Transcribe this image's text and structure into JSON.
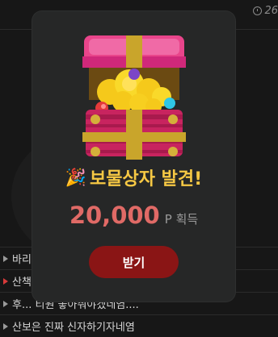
{
  "background": {
    "time_text": "26",
    "list_items": [
      {
        "text": "바리",
        "arrow_color": "#9a9a9a"
      },
      {
        "text": "산책",
        "arrow_color": "#d73a3a"
      },
      {
        "text": "후... 티원 놓아줘야겠네염....",
        "arrow_color": "#9a9a9a"
      },
      {
        "text": "산보은 진짜 신자하기자네염",
        "arrow_color": "#9a9a9a"
      }
    ]
  },
  "modal": {
    "icon": "treasure-chest-icon",
    "title_emoji": "🎉",
    "title": "보물상자 발견!",
    "reward_amount": "20,000",
    "reward_unit": "P 획득",
    "button_label": "받기",
    "colors": {
      "title": "#f6c844",
      "amount": "#e06a66",
      "button": "#8a1515"
    }
  }
}
